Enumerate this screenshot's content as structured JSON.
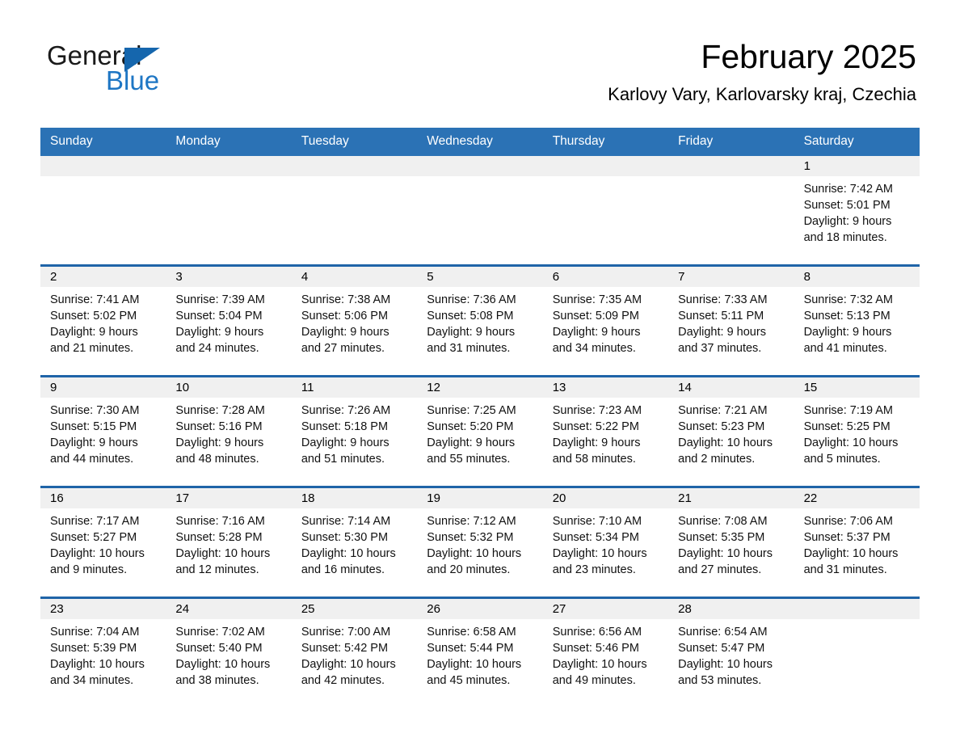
{
  "logo": {
    "line1": "General",
    "line2": "Blue",
    "triangle_color": "#1566ad",
    "blue_color": "#1e76c4"
  },
  "header": {
    "title": "February 2025",
    "subtitle": "Karlovy Vary, Karlovarsky kraj, Czechia"
  },
  "theme": {
    "header_blue": "#2b72b5",
    "row_divider_blue": "#1f64a8",
    "daynum_band": "#f0f0f0"
  },
  "weekdays": [
    "Sunday",
    "Monday",
    "Tuesday",
    "Wednesday",
    "Thursday",
    "Friday",
    "Saturday"
  ],
  "weeks": [
    [
      {
        "day": "",
        "empty": true
      },
      {
        "day": "",
        "empty": true
      },
      {
        "day": "",
        "empty": true
      },
      {
        "day": "",
        "empty": true
      },
      {
        "day": "",
        "empty": true
      },
      {
        "day": "",
        "empty": true
      },
      {
        "day": "1",
        "sunrise": "Sunrise: 7:42 AM",
        "sunset": "Sunset: 5:01 PM",
        "daylight": "Daylight: 9 hours and 18 minutes."
      }
    ],
    [
      {
        "day": "2",
        "sunrise": "Sunrise: 7:41 AM",
        "sunset": "Sunset: 5:02 PM",
        "daylight": "Daylight: 9 hours and 21 minutes."
      },
      {
        "day": "3",
        "sunrise": "Sunrise: 7:39 AM",
        "sunset": "Sunset: 5:04 PM",
        "daylight": "Daylight: 9 hours and 24 minutes."
      },
      {
        "day": "4",
        "sunrise": "Sunrise: 7:38 AM",
        "sunset": "Sunset: 5:06 PM",
        "daylight": "Daylight: 9 hours and 27 minutes."
      },
      {
        "day": "5",
        "sunrise": "Sunrise: 7:36 AM",
        "sunset": "Sunset: 5:08 PM",
        "daylight": "Daylight: 9 hours and 31 minutes."
      },
      {
        "day": "6",
        "sunrise": "Sunrise: 7:35 AM",
        "sunset": "Sunset: 5:09 PM",
        "daylight": "Daylight: 9 hours and 34 minutes."
      },
      {
        "day": "7",
        "sunrise": "Sunrise: 7:33 AM",
        "sunset": "Sunset: 5:11 PM",
        "daylight": "Daylight: 9 hours and 37 minutes."
      },
      {
        "day": "8",
        "sunrise": "Sunrise: 7:32 AM",
        "sunset": "Sunset: 5:13 PM",
        "daylight": "Daylight: 9 hours and 41 minutes."
      }
    ],
    [
      {
        "day": "9",
        "sunrise": "Sunrise: 7:30 AM",
        "sunset": "Sunset: 5:15 PM",
        "daylight": "Daylight: 9 hours and 44 minutes."
      },
      {
        "day": "10",
        "sunrise": "Sunrise: 7:28 AM",
        "sunset": "Sunset: 5:16 PM",
        "daylight": "Daylight: 9 hours and 48 minutes."
      },
      {
        "day": "11",
        "sunrise": "Sunrise: 7:26 AM",
        "sunset": "Sunset: 5:18 PM",
        "daylight": "Daylight: 9 hours and 51 minutes."
      },
      {
        "day": "12",
        "sunrise": "Sunrise: 7:25 AM",
        "sunset": "Sunset: 5:20 PM",
        "daylight": "Daylight: 9 hours and 55 minutes."
      },
      {
        "day": "13",
        "sunrise": "Sunrise: 7:23 AM",
        "sunset": "Sunset: 5:22 PM",
        "daylight": "Daylight: 9 hours and 58 minutes."
      },
      {
        "day": "14",
        "sunrise": "Sunrise: 7:21 AM",
        "sunset": "Sunset: 5:23 PM",
        "daylight": "Daylight: 10 hours and 2 minutes."
      },
      {
        "day": "15",
        "sunrise": "Sunrise: 7:19 AM",
        "sunset": "Sunset: 5:25 PM",
        "daylight": "Daylight: 10 hours and 5 minutes."
      }
    ],
    [
      {
        "day": "16",
        "sunrise": "Sunrise: 7:17 AM",
        "sunset": "Sunset: 5:27 PM",
        "daylight": "Daylight: 10 hours and 9 minutes."
      },
      {
        "day": "17",
        "sunrise": "Sunrise: 7:16 AM",
        "sunset": "Sunset: 5:28 PM",
        "daylight": "Daylight: 10 hours and 12 minutes."
      },
      {
        "day": "18",
        "sunrise": "Sunrise: 7:14 AM",
        "sunset": "Sunset: 5:30 PM",
        "daylight": "Daylight: 10 hours and 16 minutes."
      },
      {
        "day": "19",
        "sunrise": "Sunrise: 7:12 AM",
        "sunset": "Sunset: 5:32 PM",
        "daylight": "Daylight: 10 hours and 20 minutes."
      },
      {
        "day": "20",
        "sunrise": "Sunrise: 7:10 AM",
        "sunset": "Sunset: 5:34 PM",
        "daylight": "Daylight: 10 hours and 23 minutes."
      },
      {
        "day": "21",
        "sunrise": "Sunrise: 7:08 AM",
        "sunset": "Sunset: 5:35 PM",
        "daylight": "Daylight: 10 hours and 27 minutes."
      },
      {
        "day": "22",
        "sunrise": "Sunrise: 7:06 AM",
        "sunset": "Sunset: 5:37 PM",
        "daylight": "Daylight: 10 hours and 31 minutes."
      }
    ],
    [
      {
        "day": "23",
        "sunrise": "Sunrise: 7:04 AM",
        "sunset": "Sunset: 5:39 PM",
        "daylight": "Daylight: 10 hours and 34 minutes."
      },
      {
        "day": "24",
        "sunrise": "Sunrise: 7:02 AM",
        "sunset": "Sunset: 5:40 PM",
        "daylight": "Daylight: 10 hours and 38 minutes."
      },
      {
        "day": "25",
        "sunrise": "Sunrise: 7:00 AM",
        "sunset": "Sunset: 5:42 PM",
        "daylight": "Daylight: 10 hours and 42 minutes."
      },
      {
        "day": "26",
        "sunrise": "Sunrise: 6:58 AM",
        "sunset": "Sunset: 5:44 PM",
        "daylight": "Daylight: 10 hours and 45 minutes."
      },
      {
        "day": "27",
        "sunrise": "Sunrise: 6:56 AM",
        "sunset": "Sunset: 5:46 PM",
        "daylight": "Daylight: 10 hours and 49 minutes."
      },
      {
        "day": "28",
        "sunrise": "Sunrise: 6:54 AM",
        "sunset": "Sunset: 5:47 PM",
        "daylight": "Daylight: 10 hours and 53 minutes."
      },
      {
        "day": "",
        "empty": true
      }
    ]
  ]
}
